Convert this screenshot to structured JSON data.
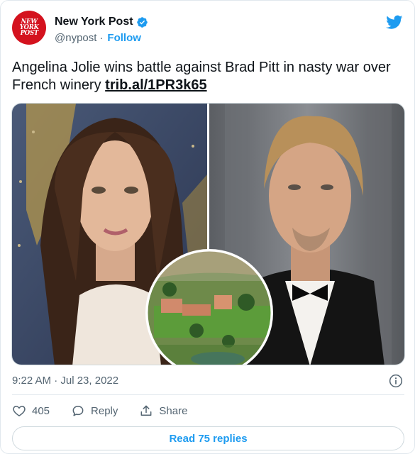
{
  "account": {
    "display_name": "New York Post",
    "handle": "@nypost",
    "separator": "·",
    "follow_label": "Follow",
    "avatar_lines": [
      "NEW",
      "YORK",
      "POST"
    ],
    "avatar_color": "#d4121e",
    "verified_icon": "verified-badge-icon",
    "platform_icon": "twitter-bird-icon",
    "brand_color": "#1d9bf0"
  },
  "tweet": {
    "text": "Angelina Jolie wins battle against Brad Pitt in nasty war over French winery",
    "link": "trib.al/1PR3k65"
  },
  "media": {
    "panels": [
      "angelina-jolie-photo",
      "brad-pitt-photo",
      "winery-aerial-photo"
    ]
  },
  "meta": {
    "timestamp": "9:22 AM · Jul 23, 2022"
  },
  "actions": {
    "like_count": "405",
    "reply_label": "Reply",
    "share_label": "Share"
  },
  "footer": {
    "read_replies_label": "Read 75 replies"
  }
}
